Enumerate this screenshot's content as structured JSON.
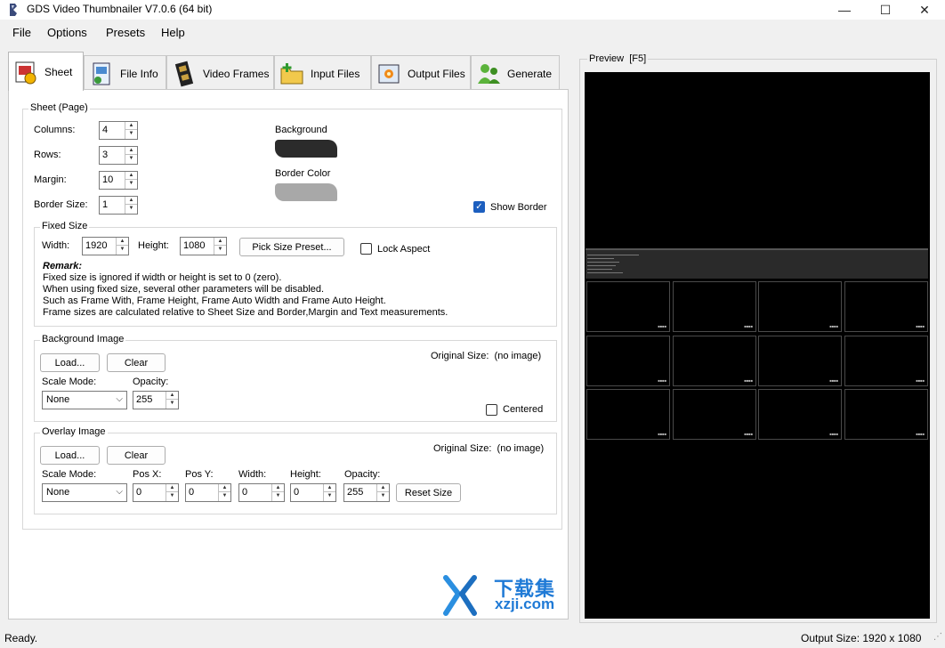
{
  "window": {
    "title": "GDS Video Thumbnailer V7.0.6 (64 bit)",
    "minimize_icon": "minimize-icon",
    "maximize_icon": "maximize-icon",
    "close_icon": "close-icon"
  },
  "menu": [
    "File",
    "Options",
    "Presets",
    "Help"
  ],
  "tabs": [
    {
      "label": "Sheet",
      "icon": "sheet-icon",
      "active": true
    },
    {
      "label": "File Info",
      "icon": "file-info-icon"
    },
    {
      "label": "Video Frames",
      "icon": "film-icon"
    },
    {
      "label": "Input Files",
      "icon": "folder-plus-icon"
    },
    {
      "label": "Output Files",
      "icon": "picture-icon"
    },
    {
      "label": "Generate",
      "icon": "people-icon"
    }
  ],
  "sheet": {
    "group_label": "Sheet (Page)",
    "columns_label": "Columns:",
    "columns": "4",
    "rows_label": "Rows:",
    "rows": "3",
    "margin_label": "Margin:",
    "margin": "10",
    "border_size_label": "Border Size:",
    "border_size": "1",
    "background_label": "Background",
    "border_color_label": "Border Color",
    "show_border_label": "Show Border",
    "show_border_checked": true,
    "colors": {
      "background": "#2b2b2b",
      "border": "#a8a8a8"
    }
  },
  "fixed_size": {
    "group_label": "Fixed Size",
    "width_label": "Width:",
    "width": "1920",
    "height_label": "Height:",
    "height": "1080",
    "pick_button": "Pick Size Preset...",
    "lock_aspect_label": "Lock Aspect",
    "remark_title": "Remark:",
    "remark_lines": [
      "Fixed size is ignored if width or height is set to 0 (zero).",
      "When using fixed size, several other parameters will be disabled.",
      "Such as Frame With, Frame Height, Frame Auto Width and Frame Auto Height.",
      "Frame sizes are calculated relative to Sheet Size and Border,Margin and Text measurements."
    ]
  },
  "background_image": {
    "group_label": "Background Image",
    "load_button": "Load...",
    "clear_button": "Clear",
    "original_size_label": "Original Size:",
    "original_size_value": "(no image)",
    "scale_mode_label": "Scale Mode:",
    "scale_mode": "None",
    "opacity_label": "Opacity:",
    "opacity": "255",
    "centered_label": "Centered"
  },
  "overlay_image": {
    "group_label": "Overlay Image",
    "load_button": "Load...",
    "clear_button": "Clear",
    "original_size_label": "Original Size:",
    "original_size_value": "(no image)",
    "scale_mode_label": "Scale Mode:",
    "scale_mode": "None",
    "pos_x_label": "Pos X:",
    "pos_x": "0",
    "pos_y_label": "Pos Y:",
    "pos_y": "0",
    "width_label": "Width:",
    "width": "0",
    "height_label": "Height:",
    "height": "0",
    "opacity_label": "Opacity:",
    "opacity": "255",
    "reset_button": "Reset Size"
  },
  "preview": {
    "label": "Preview",
    "shortcut": "[F5]"
  },
  "watermark": {
    "cn": "下载集",
    "site": "xzji.com"
  },
  "status": {
    "left": "Ready.",
    "right": "Output Size: 1920 x 1080"
  }
}
